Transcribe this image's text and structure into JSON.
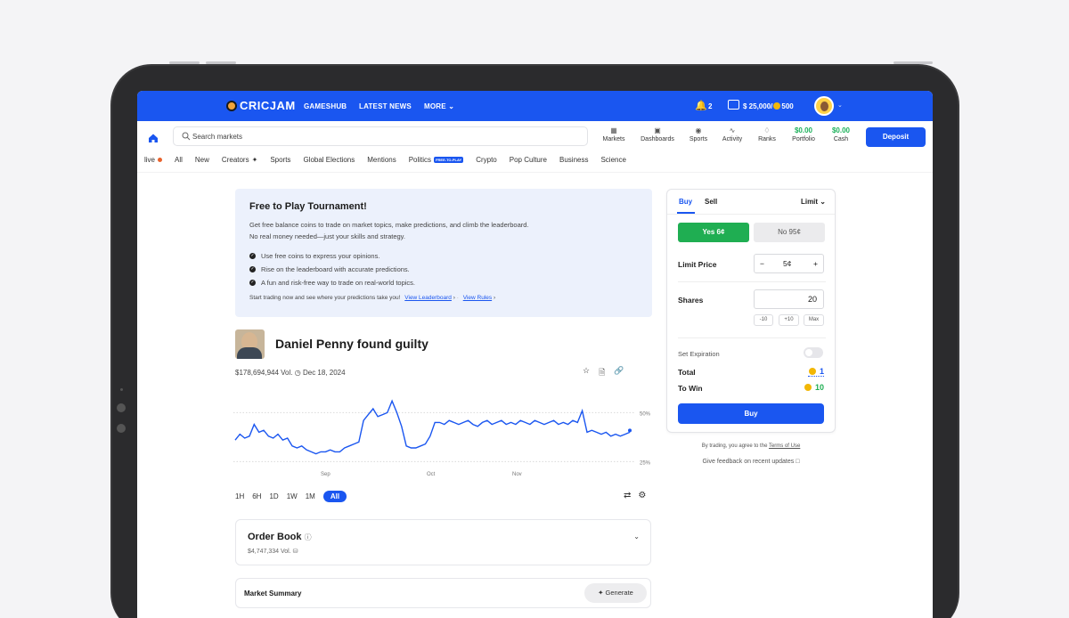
{
  "brand": "CRICJAM",
  "top_nav": {
    "items": [
      "GAMESHUB",
      "LATEST NEWS",
      "MORE"
    ],
    "notifications_count": "2",
    "balance": "$ 25,000/",
    "coins": "500"
  },
  "search": {
    "placeholder": "Search markets"
  },
  "quick_nav": [
    {
      "label": "Markets",
      "icon": "grid-icon"
    },
    {
      "label": "Dashboards",
      "icon": "dashboard-icon"
    },
    {
      "label": "Sports",
      "icon": "sports-icon"
    },
    {
      "label": "Activity",
      "icon": "activity-icon"
    },
    {
      "label": "Ranks",
      "icon": "trophy-icon"
    },
    {
      "label": "Portfolio",
      "value": "$0.00"
    },
    {
      "label": "Cash",
      "value": "$0.00"
    }
  ],
  "deposit_label": "Deposit",
  "categories": {
    "live": "live",
    "items": [
      "All",
      "New",
      "Creators",
      "Sports",
      "Global Elections",
      "Mentions",
      "Politics",
      "Crypto",
      "Pop Culture",
      "Business",
      "Science"
    ],
    "politics_badge": "FREE-TO-PLAY"
  },
  "promo": {
    "title": "Free to Play Tournament!",
    "description_line1": "Get free balance coins to trade on market topics, make predictions, and climb the leaderboard.",
    "description_line2": "No real money needed—just your skills and strategy.",
    "bullets": [
      "Use free coins to express your opinions.",
      "Rise on the leaderboard with accurate predictions.",
      "A fun and risk-free way to trade on real-world topics."
    ],
    "footer": "Start trading now and see where your predictions take you!",
    "link_leaderboard": "View Leaderboard",
    "link_rules": "View Rules"
  },
  "market": {
    "title": "Daniel Penny found guilty",
    "volume": "$178,694,944 Vol.",
    "date": "Dec 18, 2024"
  },
  "chart_data": {
    "type": "line",
    "x_tick_labels": [
      "Sep",
      "Oct",
      "Nov"
    ],
    "y_tick_labels": [
      "50%",
      "25%"
    ],
    "ylim": [
      22,
      62
    ],
    "series": [
      {
        "values": [
          36,
          39,
          37,
          38,
          44,
          40,
          41,
          38,
          37,
          39,
          36,
          37,
          33,
          32,
          33,
          31,
          30,
          29,
          30,
          30,
          31,
          30,
          30,
          32,
          33,
          34,
          35,
          46,
          49,
          52,
          48,
          49,
          50,
          56,
          50,
          43,
          33,
          32,
          32,
          33,
          34,
          38,
          45,
          45,
          44,
          46,
          45,
          44,
          45,
          46,
          44,
          43,
          45,
          46,
          44,
          45,
          46,
          44,
          45,
          44,
          46,
          45,
          44,
          46,
          45,
          44,
          45,
          46,
          44,
          45,
          44,
          46,
          45,
          51,
          40,
          41,
          40,
          39,
          40,
          38,
          39,
          38,
          39,
          40
        ]
      }
    ]
  },
  "time_ranges": [
    "1H",
    "6H",
    "1D",
    "1W",
    "1M",
    "All"
  ],
  "active_range": "All",
  "order_book": {
    "title": "Order Book",
    "volume": "$4,747,334 Vol."
  },
  "summary": {
    "title": "Market Summary",
    "button": "Generate"
  },
  "trade": {
    "tab_buy": "Buy",
    "tab_sell": "Sell",
    "order_type": "Limit",
    "yes_label": "Yes 6¢",
    "no_label": "No 95¢",
    "limit_price_label": "Limit Price",
    "limit_price": "5¢",
    "shares_label": "Shares",
    "shares": "20",
    "chips": [
      "-10",
      "+10",
      "Max"
    ],
    "expiration_label": "Set Expiration",
    "total_label": "Total",
    "total_value": "1",
    "to_win_label": "To Win",
    "to_win_value": "10",
    "buy_label": "Buy"
  },
  "terms_text": "By trading, you agree to the",
  "terms_link": "Terms of Use",
  "feedback_text": "Give feedback on recent updates"
}
